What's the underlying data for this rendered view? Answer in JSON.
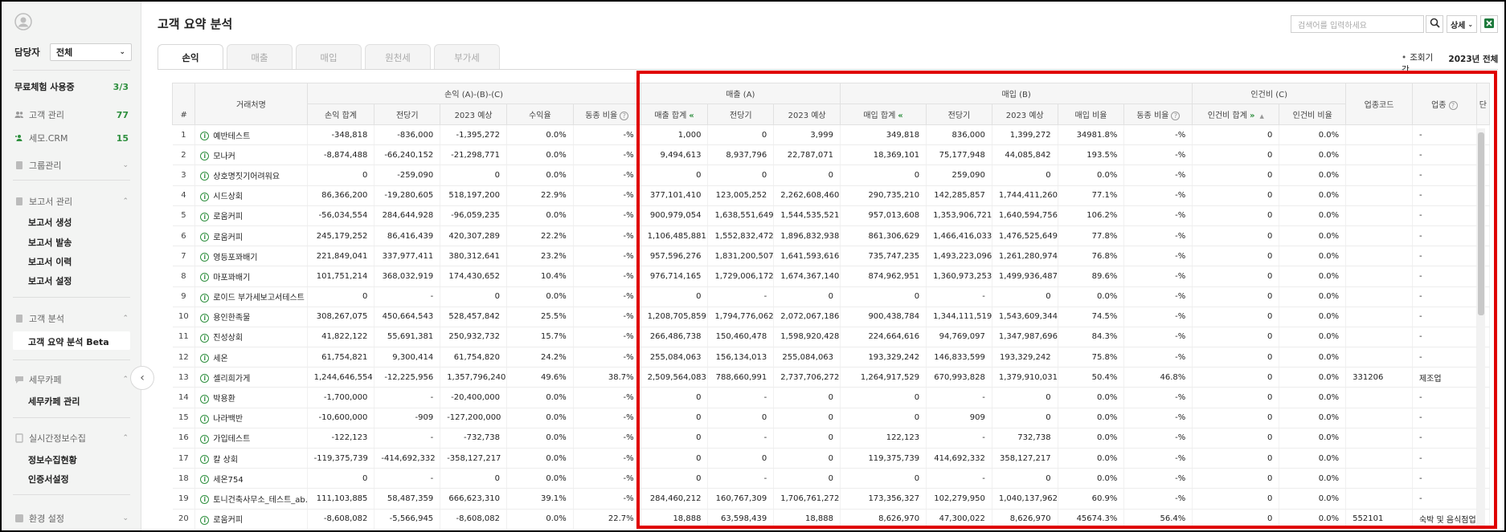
{
  "sidebar": {
    "owner_label": "담당자",
    "owner_value": "전체",
    "trial_label": "무료체험 사용중",
    "trial_count": "3/3",
    "customer_mgmt": "고객 관리",
    "customer_mgmt_count": "77",
    "semo_crm": "세모.CRM",
    "semo_crm_count": "15",
    "group_mgmt": "그룹관리",
    "report_mgmt": "보고서 관리",
    "report_items": [
      "보고서 생성",
      "보고서 발송",
      "보고서 이력",
      "보고서 설정"
    ],
    "customer_analysis": "고객 분석",
    "analysis_items": [
      "고객 요약 분석 Beta"
    ],
    "tax_cafe": "세무카페",
    "cafe_items": [
      "세무카페 관리"
    ],
    "realtime": "실시간정보수집",
    "realtime_items": [
      "정보수집현황",
      "인증서설정"
    ],
    "env_settings": "환경 설정"
  },
  "header": {
    "title": "고객 요약 분석",
    "search_placeholder": "검색어를 입력하세요",
    "detail_label": "상세",
    "period_label": "조회기간",
    "period_value": "2023년 전체"
  },
  "tabs": [
    "손익",
    "매출",
    "매입",
    "원천세",
    "부가세"
  ],
  "columns": {
    "number": "#",
    "client": "거래처명",
    "group_pl": "손익 (A)-(B)-(C)",
    "group_sales": "매출 (A)",
    "group_purchase": "매입 (B)",
    "group_labor": "인건비 (C)",
    "industry_code": "업종코드",
    "industry": "업종",
    "overflow": "단",
    "pl": [
      "손익 합계",
      "전당기",
      "2023 예상",
      "수익율",
      "동종 비율"
    ],
    "sales": [
      "매출 합계",
      "전당기",
      "2023 예상"
    ],
    "purchase": [
      "매입 합계",
      "전당기",
      "2023 예상",
      "매입 비율",
      "동종 비율"
    ],
    "labor": [
      "인건비 합계",
      "인건비 비율"
    ]
  },
  "rows": [
    {
      "n": "1",
      "name": "예반테스트",
      "pl": [
        "-348,818",
        "-836,000",
        "-1,395,272",
        "0.0%",
        "-%"
      ],
      "sales": [
        "1,000",
        "0",
        "3,999"
      ],
      "pur": [
        "349,818",
        "836,000",
        "1,399,272",
        "34981.8%",
        "-%"
      ],
      "lab": [
        "0",
        "0.0%"
      ],
      "code": "",
      "ind": "-"
    },
    {
      "n": "2",
      "name": "모나커",
      "pl": [
        "-8,874,488",
        "-66,240,152",
        "-21,298,771",
        "0.0%",
        "-%"
      ],
      "sales": [
        "9,494,613",
        "8,937,796",
        "22,787,071"
      ],
      "pur": [
        "18,369,101",
        "75,177,948",
        "44,085,842",
        "193.5%",
        "-%"
      ],
      "lab": [
        "0",
        "0.0%"
      ],
      "code": "",
      "ind": "-"
    },
    {
      "n": "3",
      "name": "상호명짓기어려워요",
      "pl": [
        "0",
        "-259,090",
        "0",
        "0.0%",
        "-%"
      ],
      "sales": [
        "0",
        "0",
        "0"
      ],
      "pur": [
        "0",
        "259,090",
        "0",
        "0.0%",
        "-%"
      ],
      "lab": [
        "0",
        "0.0%"
      ],
      "code": "",
      "ind": "-"
    },
    {
      "n": "4",
      "name": "시드상회",
      "pl": [
        "86,366,200",
        "-19,280,605",
        "518,197,200",
        "22.9%",
        "-%"
      ],
      "sales": [
        "377,101,410",
        "123,005,252",
        "2,262,608,460"
      ],
      "pur": [
        "290,735,210",
        "142,285,857",
        "1,744,411,260",
        "77.1%",
        "-%"
      ],
      "lab": [
        "0",
        "0.0%"
      ],
      "code": "",
      "ind": "-"
    },
    {
      "n": "5",
      "name": "로움커피",
      "pl": [
        "-56,034,554",
        "284,644,928",
        "-96,059,235",
        "0.0%",
        "-%"
      ],
      "sales": [
        "900,979,054",
        "1,638,551,649",
        "1,544,535,521"
      ],
      "pur": [
        "957,013,608",
        "1,353,906,721",
        "1,640,594,756",
        "106.2%",
        "-%"
      ],
      "lab": [
        "0",
        "0.0%"
      ],
      "code": "",
      "ind": "-"
    },
    {
      "n": "6",
      "name": "로움커피",
      "pl": [
        "245,179,252",
        "86,416,439",
        "420,307,289",
        "22.2%",
        "-%"
      ],
      "sales": [
        "1,106,485,881",
        "1,552,832,472",
        "1,896,832,938"
      ],
      "pur": [
        "861,306,629",
        "1,466,416,033",
        "1,476,525,649",
        "77.8%",
        "-%"
      ],
      "lab": [
        "0",
        "0.0%"
      ],
      "code": "",
      "ind": "-"
    },
    {
      "n": "7",
      "name": "영등포꽈배기",
      "pl": [
        "221,849,041",
        "337,977,411",
        "380,312,641",
        "23.2%",
        "-%"
      ],
      "sales": [
        "957,596,276",
        "1,831,200,507",
        "1,641,593,616"
      ],
      "pur": [
        "735,747,235",
        "1,493,223,096",
        "1,261,280,974",
        "76.8%",
        "-%"
      ],
      "lab": [
        "0",
        "0.0%"
      ],
      "code": "",
      "ind": "-"
    },
    {
      "n": "8",
      "name": "마포꽈배기",
      "pl": [
        "101,751,214",
        "368,032,919",
        "174,430,652",
        "10.4%",
        "-%"
      ],
      "sales": [
        "976,714,165",
        "1,729,006,172",
        "1,674,367,140"
      ],
      "pur": [
        "874,962,951",
        "1,360,973,253",
        "1,499,936,487",
        "89.6%",
        "-%"
      ],
      "lab": [
        "0",
        "0.0%"
      ],
      "code": "",
      "ind": "-"
    },
    {
      "n": "9",
      "name": "로이드 부가세보고서테스트",
      "pl": [
        "0",
        "-",
        "0",
        "0.0%",
        "-%"
      ],
      "sales": [
        "0",
        "-",
        "0"
      ],
      "pur": [
        "0",
        "-",
        "0",
        "0.0%",
        "-%"
      ],
      "lab": [
        "0",
        "0.0%"
      ],
      "code": "",
      "ind": "-"
    },
    {
      "n": "10",
      "name": "용인한족물",
      "pl": [
        "308,267,075",
        "450,664,543",
        "528,457,842",
        "25.5%",
        "-%"
      ],
      "sales": [
        "1,208,705,859",
        "1,794,776,062",
        "2,072,067,186"
      ],
      "pur": [
        "900,438,784",
        "1,344,111,519",
        "1,543,609,344",
        "74.5%",
        "-%"
      ],
      "lab": [
        "0",
        "0.0%"
      ],
      "code": "",
      "ind": "-"
    },
    {
      "n": "11",
      "name": "진성상회",
      "pl": [
        "41,822,122",
        "55,691,381",
        "250,932,732",
        "15.7%",
        "-%"
      ],
      "sales": [
        "266,486,738",
        "150,460,478",
        "1,598,920,428"
      ],
      "pur": [
        "224,664,616",
        "94,769,097",
        "1,347,987,696",
        "84.3%",
        "-%"
      ],
      "lab": [
        "0",
        "0.0%"
      ],
      "code": "",
      "ind": "-"
    },
    {
      "n": "12",
      "name": "세온",
      "pl": [
        "61,754,821",
        "9,300,414",
        "61,754,820",
        "24.2%",
        "-%"
      ],
      "sales": [
        "255,084,063",
        "156,134,013",
        "255,084,063"
      ],
      "pur": [
        "193,329,242",
        "146,833,599",
        "193,329,242",
        "75.8%",
        "-%"
      ],
      "lab": [
        "0",
        "0.0%"
      ],
      "code": "",
      "ind": "-"
    },
    {
      "n": "13",
      "name": "셀리희가게",
      "pl": [
        "1,244,646,554",
        "-12,225,956",
        "1,357,796,240",
        "49.6%",
        "38.7%"
      ],
      "sales": [
        "2,509,564,083",
        "788,660,991",
        "2,737,706,272"
      ],
      "pur": [
        "1,264,917,529",
        "670,993,828",
        "1,379,910,031",
        "50.4%",
        "46.8%"
      ],
      "lab": [
        "0",
        "0.0%"
      ],
      "code": "331206",
      "ind": "제조업"
    },
    {
      "n": "14",
      "name": "박용환",
      "pl": [
        "-1,700,000",
        "-",
        "-20,400,000",
        "0.0%",
        "-%"
      ],
      "sales": [
        "0",
        "-",
        "0"
      ],
      "pur": [
        "0",
        "-",
        "0",
        "0.0%",
        "-%"
      ],
      "lab": [
        "0",
        "0.0%"
      ],
      "code": "",
      "ind": "-"
    },
    {
      "n": "15",
      "name": "나라백반",
      "pl": [
        "-10,600,000",
        "-909",
        "-127,200,000",
        "0.0%",
        "-%"
      ],
      "sales": [
        "0",
        "0",
        "0"
      ],
      "pur": [
        "0",
        "909",
        "0",
        "0.0%",
        "-%"
      ],
      "lab": [
        "0",
        "0.0%"
      ],
      "code": "",
      "ind": "-"
    },
    {
      "n": "16",
      "name": "가입테스트",
      "pl": [
        "-122,123",
        "-",
        "-732,738",
        "0.0%",
        "-%"
      ],
      "sales": [
        "0",
        "-",
        "0"
      ],
      "pur": [
        "122,123",
        "-",
        "732,738",
        "0.0%",
        "-%"
      ],
      "lab": [
        "0",
        "0.0%"
      ],
      "code": "",
      "ind": "-"
    },
    {
      "n": "17",
      "name": "칼 상회",
      "pl": [
        "-119,375,739",
        "-414,692,332",
        "-358,127,217",
        "0.0%",
        "-%"
      ],
      "sales": [
        "0",
        "0",
        "0"
      ],
      "pur": [
        "119,375,739",
        "414,692,332",
        "358,127,217",
        "0.0%",
        "-%"
      ],
      "lab": [
        "0",
        "0.0%"
      ],
      "code": "",
      "ind": "-"
    },
    {
      "n": "18",
      "name": "세온754",
      "pl": [
        "0",
        "-",
        "0",
        "0.0%",
        "-%"
      ],
      "sales": [
        "0",
        "-",
        "0"
      ],
      "pur": [
        "0",
        "-",
        "0",
        "0.0%",
        "-%"
      ],
      "lab": [
        "0",
        "0.0%"
      ],
      "code": "",
      "ind": "-"
    },
    {
      "n": "19",
      "name": "토니건축사무소_테스트_ab...",
      "pl": [
        "111,103,885",
        "58,487,359",
        "666,623,310",
        "39.1%",
        "-%"
      ],
      "sales": [
        "284,460,212",
        "160,767,309",
        "1,706,761,272"
      ],
      "pur": [
        "173,356,327",
        "102,279,950",
        "1,040,137,962",
        "60.9%",
        "-%"
      ],
      "lab": [
        "0",
        "0.0%"
      ],
      "code": "",
      "ind": "-"
    },
    {
      "n": "20",
      "name": "로움커피",
      "pl": [
        "-8,608,082",
        "-5,566,945",
        "-8,608,082",
        "0.0%",
        "22.7%"
      ],
      "sales": [
        "18,888",
        "63,598,439",
        "18,888"
      ],
      "pur": [
        "8,626,970",
        "47,300,022",
        "8,626,970",
        "45674.3%",
        "56.4%"
      ],
      "lab": [
        "0",
        "0.0%"
      ],
      "code": "552101",
      "ind": "숙박 및 음식점업"
    }
  ],
  "colors": {
    "accent_green": "#2e8f3e",
    "highlight_red": "#e00000",
    "sidebar_bg": "#f3f4f3"
  }
}
